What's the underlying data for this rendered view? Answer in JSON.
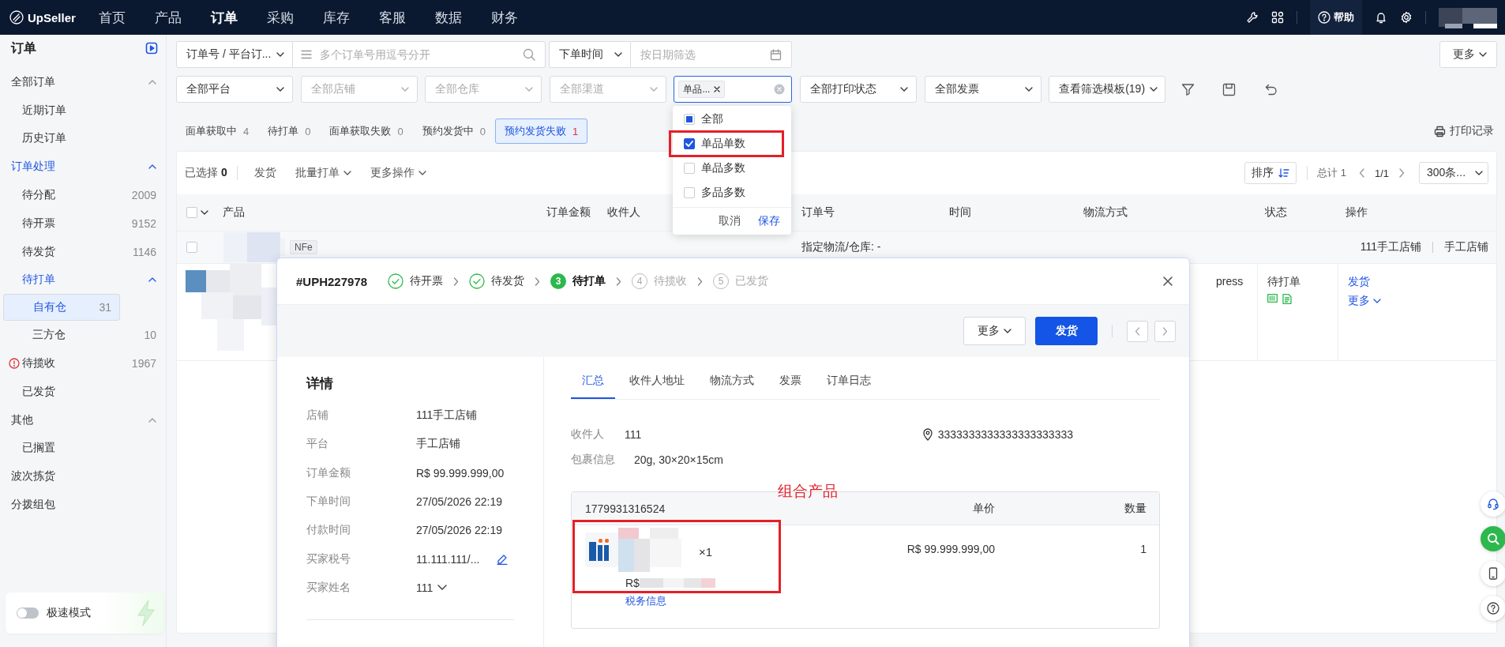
{
  "top_bar": {
    "brand": "UpSeller",
    "nav": [
      {
        "label": "首页",
        "selected": false
      },
      {
        "label": "产品",
        "selected": false
      },
      {
        "label": "订单",
        "selected": true
      },
      {
        "label": "采购",
        "selected": false
      },
      {
        "label": "库存",
        "selected": false
      },
      {
        "label": "客服",
        "selected": false
      },
      {
        "label": "数据",
        "selected": false
      },
      {
        "label": "财务",
        "selected": false
      }
    ],
    "help": "帮助"
  },
  "sidebar": {
    "title": "订单",
    "items": [
      {
        "label": "全部订单",
        "expanded": true,
        "selected": false,
        "warning": false,
        "children": [
          {
            "label": "近期订单",
            "selected": false,
            "warning": false
          },
          {
            "label": "历史订单",
            "selected": false,
            "warning": false
          }
        ]
      },
      {
        "label": "订单处理",
        "expanded": true,
        "selected": false,
        "warning": false,
        "children": [
          {
            "label": "待分配",
            "count": "2009",
            "selected": false,
            "warning": false
          },
          {
            "label": "待开票",
            "count": "9152",
            "selected": false,
            "warning": false
          },
          {
            "label": "待发货",
            "count": "1146",
            "selected": false,
            "warning": false
          },
          {
            "label": "待打单",
            "expanded": true,
            "selected": false,
            "warning": false,
            "children": [
              {
                "label": "自有仓",
                "count": "31",
                "selected": true,
                "warning": false
              },
              {
                "label": "三方仓",
                "count": "10",
                "selected": false,
                "warning": false
              }
            ]
          },
          {
            "label": "待揽收",
            "count": "1967",
            "selected": false,
            "warning": true
          },
          {
            "label": "已发货",
            "selected": false,
            "warning": false
          }
        ]
      },
      {
        "label": "其他",
        "expanded": true,
        "selected": false,
        "warning": false,
        "children": [
          {
            "label": "已搁置",
            "selected": false,
            "warning": false
          }
        ]
      },
      {
        "label": "波次拣货",
        "selected": false,
        "warning": false
      },
      {
        "label": "分拨组包",
        "selected": false,
        "warning": false
      }
    ],
    "fast_mode": {
      "label": "极速模式",
      "on": false
    }
  },
  "filters": {
    "order_field": "订单号 / 平台订...",
    "order_search": {
      "placeholder": "多个订单号用逗号分开"
    },
    "time_field": "下单时间",
    "date_search": {
      "placeholder": "按日期筛选"
    },
    "more_button": "更多",
    "selects": [
      {
        "kind": "select",
        "value": "全部平台"
      },
      {
        "kind": "select",
        "placeholder": "全部店铺"
      },
      {
        "kind": "select",
        "placeholder": "全部仓库"
      },
      {
        "kind": "select",
        "placeholder": "全部渠道"
      },
      {
        "kind": "tags",
        "tags": [
          "单品..."
        ],
        "dropdown": {
          "options": [
            {
              "label": "全部",
              "checked": false,
              "partial": true
            },
            {
              "label": "单品单数",
              "checked": true,
              "partial": false
            },
            {
              "label": "单品多数",
              "checked": false,
              "partial": false
            },
            {
              "label": "多品多数",
              "checked": false,
              "partial": false
            }
          ],
          "cancel": "取消",
          "save": "保存"
        }
      },
      {
        "kind": "select",
        "value": "全部打印状态"
      },
      {
        "kind": "select",
        "value": "全部发票"
      },
      {
        "kind": "select",
        "value": "查看筛选模板(19)"
      }
    ]
  },
  "status_tabs": [
    {
      "label": "面单获取中",
      "count": "4",
      "selected": false
    },
    {
      "label": "待打单",
      "count": "0",
      "selected": false
    },
    {
      "label": "面单获取失败",
      "count": "0",
      "selected": false
    },
    {
      "label": "预约发货中",
      "count": "0",
      "selected": false
    },
    {
      "label": "预约发货失败",
      "count": "1",
      "selected": true
    }
  ],
  "print_record": "打印记录",
  "table": {
    "toolbar": {
      "selected_label": "已选择",
      "selected_count": "0",
      "actions": [
        {
          "label": "发货",
          "menu": false
        },
        {
          "label": "批量打单",
          "menu": true
        },
        {
          "label": "更多操作",
          "menu": true
        }
      ],
      "sort": "排序",
      "total": "总计 1",
      "page": "1/1",
      "page_size": "300条..."
    },
    "select_all": {
      "checked": false
    },
    "columns": [
      "产品",
      "订单金额",
      "收件人",
      "订单号",
      "时间",
      "物流方式",
      "状态",
      "操作"
    ],
    "group_row": {
      "checked": false,
      "tag": "NFe",
      "logistics": "指定物流/仓库: -",
      "shop": "111手工店铺",
      "platform": "手工店铺"
    },
    "order_row": {
      "logistics": "press",
      "status": "待打单",
      "actions": [
        {
          "label": "发货",
          "menu": false
        },
        {
          "label": "更多",
          "menu": true
        }
      ]
    }
  },
  "modal": {
    "order_no": "#UPH227978",
    "steps": [
      {
        "label": "待开票",
        "done": true,
        "current": false
      },
      {
        "label": "待发货",
        "done": true,
        "current": false
      },
      {
        "number": "3",
        "label": "待打单",
        "done": false,
        "current": true
      },
      {
        "number": "4",
        "label": "待揽收",
        "done": false,
        "current": false
      },
      {
        "number": "5",
        "label": "已发货",
        "done": false,
        "current": false
      }
    ],
    "buttons": [
      {
        "label": "更多",
        "kind": "menu"
      },
      {
        "label": "发货",
        "kind": "primary"
      }
    ],
    "details": {
      "title": "详情",
      "rows": [
        {
          "label": "店铺",
          "value": "111手工店铺",
          "kind": "text"
        },
        {
          "label": "平台",
          "value": "手工店铺",
          "kind": "text"
        },
        {
          "label": "订单金额",
          "value": "R$ 99.999.999,00",
          "kind": "text"
        },
        {
          "label": "下单时间",
          "value": "27/05/2026 22:19",
          "kind": "text"
        },
        {
          "label": "付款时间",
          "value": "27/05/2026 22:19",
          "kind": "text"
        },
        {
          "label": "买家税号",
          "value": "11.111.111/...",
          "kind": "editable"
        },
        {
          "label": "买家姓名",
          "value": "111",
          "kind": "dropdown"
        }
      ]
    },
    "tabs": [
      {
        "label": "汇总",
        "selected": true
      },
      {
        "label": "收件人地址",
        "selected": false
      },
      {
        "label": "物流方式",
        "selected": false
      },
      {
        "label": "发票",
        "selected": false
      },
      {
        "label": "订单日志",
        "selected": false
      }
    ],
    "recipient": {
      "label": "收件人",
      "value": "111"
    },
    "address": "3333333333333333333333",
    "package": {
      "label": "包裹信息",
      "value": "20g, 30×20×15cm"
    },
    "items_table": {
      "columns": [
        "1779931316524",
        "单价",
        "数量"
      ],
      "rows": [
        {
          "multiplier": "×1",
          "price_prefix": "R$",
          "tax_link": "税务信息",
          "unit_price": "R$ 99.999.999,00",
          "quantity": "1"
        }
      ]
    }
  },
  "annotation": {
    "label": "组合产品"
  }
}
